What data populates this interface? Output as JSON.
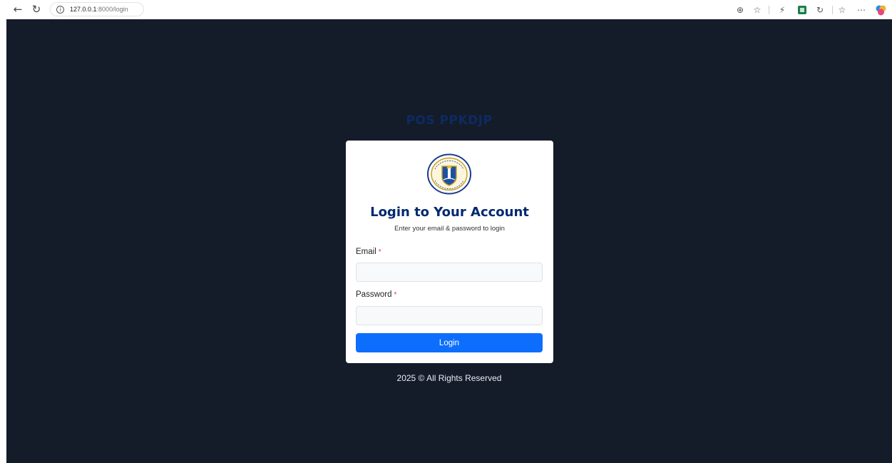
{
  "browser": {
    "back_icon": "arrow-left-icon",
    "reload_icon": "reload-icon",
    "url_host": "127.0.0.1",
    "url_path": ":8000/login"
  },
  "page": {
    "brand": "POS PPKDJP",
    "card": {
      "title": "Login to Your Account",
      "subtitle": "Enter your email & password to login",
      "email_label": "Email",
      "password_label": "Password",
      "required_mark": "*",
      "email_value": "",
      "password_value": "",
      "login_button": "Login"
    },
    "footer": "2025 © All Rights Reserved"
  },
  "colors": {
    "background": "#141c2a",
    "brand": "#0e2a63",
    "title": "#012970",
    "primary": "#0d6efd",
    "required": "#dc3545"
  }
}
